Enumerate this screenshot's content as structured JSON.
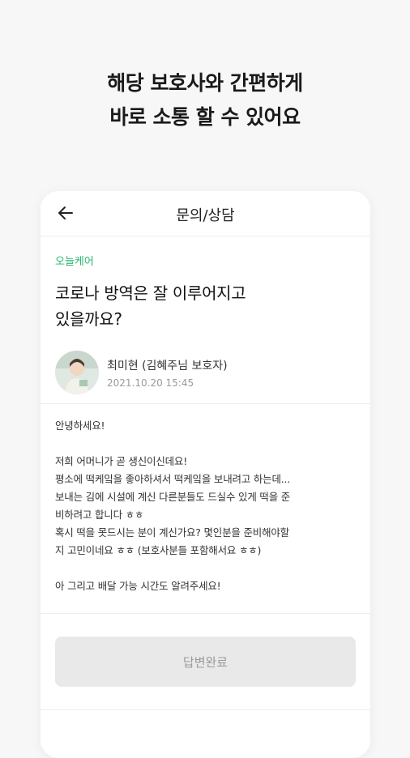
{
  "promo": {
    "line1": "해당 보호사와 간편하게",
    "line2": "바로 소통 할 수 있어요"
  },
  "appbar": {
    "title": "문의/상담",
    "back_icon": "arrow-left-icon"
  },
  "post": {
    "tag": "오늘케어",
    "title_line1": "코로나 방역은 잘 이루어지고",
    "title_line2": "있을까요?",
    "author_name": "최미현 (김혜주님 보호자)",
    "date": "2021.10.20 15:45",
    "body": "안녕하세요!\n\n저희 어머니가 곧 생신이신데요!\n평소에 떡케잌을 좋아하셔서 떡케잌을 보내려고 하는데...\n보내는 김에 시설에 계신 다른분들도 드실수 있게 떡을 준\n비하려고 합니다 ㅎㅎ\n혹시 떡을 못드시는 분이 계신가요? 몇인분을 준비해야할\n지 고민이네요 ㅎㅎ (보호사분들 포함해서요 ㅎㅎ)\n\n아 그리고 배달 가능 시간도 알려주세요!"
  },
  "action": {
    "status_label": "답변완료"
  },
  "colors": {
    "accent": "#2bb673",
    "disabled_bg": "#e9e9e9",
    "disabled_text": "#9a9a9a"
  }
}
